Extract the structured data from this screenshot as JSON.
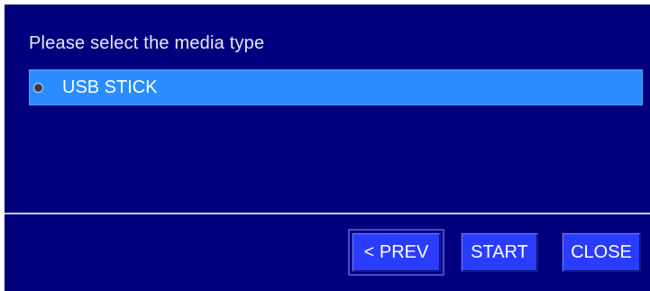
{
  "dialog": {
    "prompt": "Please select the media type",
    "media_options": [
      {
        "label": "USB STICK",
        "selected": true
      }
    ],
    "buttons": {
      "prev_label": "< PREV",
      "start_label": "START",
      "close_label": "CLOSE"
    }
  },
  "colors": {
    "background": "#00007e",
    "selection": "#2a8dff",
    "button": "#2a3cff",
    "text": "#ffffff"
  },
  "icons": {
    "radio": "radio-selected-icon"
  }
}
